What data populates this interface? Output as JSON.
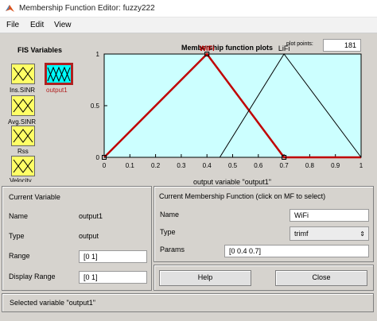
{
  "window": {
    "title": "Membership Function Editor: fuzzy222"
  },
  "menu": [
    "File",
    "Edit",
    "View"
  ],
  "fis_panel": {
    "title": "FIS Variables",
    "inputs": [
      "Ins.SINR",
      "Avg.SINR",
      "Rss",
      "Velocity"
    ],
    "output": "output1"
  },
  "plot": {
    "title": "Membership function plots",
    "points_label": "plot points:",
    "points_value": "181"
  },
  "chart_data": {
    "type": "line",
    "xlabel": "output variable \"output1\"",
    "xlim": [
      0,
      1
    ],
    "ylim": [
      0,
      1
    ],
    "x_ticks": [
      "0",
      "0.1",
      "0.2",
      "0.3",
      "0.4",
      "0.5",
      "0.6",
      "0.7",
      "0.8",
      "0.9",
      "1"
    ],
    "y_ticks": [
      "0",
      "0.5",
      "1"
    ],
    "series": [
      {
        "name": "WiFi",
        "shape": "trimf",
        "params": [
          0,
          0.4,
          0.7
        ],
        "selected": true,
        "color": "#c00000"
      },
      {
        "name": "LiFi",
        "shape": "trimf",
        "params": [
          0.45,
          0.7,
          1.0
        ],
        "selected": false,
        "color": "#000000"
      }
    ]
  },
  "current_variable": {
    "title": "Current Variable",
    "name_label": "Name",
    "name_value": "output1",
    "type_label": "Type",
    "type_value": "output",
    "range_label": "Range",
    "range_value": "[0 1]",
    "display_label": "Display Range",
    "display_value": "[0 1]"
  },
  "current_mf": {
    "title": "Current Membership Function (click on MF to select)",
    "name_label": "Name",
    "name_value": "WiFi",
    "type_label": "Type",
    "type_value": "trimf",
    "params_label": "Params",
    "params_value": "[0 0.4 0.7]"
  },
  "buttons": {
    "help": "Help",
    "close": "Close"
  },
  "status": "Selected variable \"output1\"",
  "colors": {
    "background": "#d6d3ce",
    "plot_bg": "#ccffff",
    "input_var": "#ffff66",
    "output_var": "#00ffff",
    "selected": "#c00000"
  }
}
